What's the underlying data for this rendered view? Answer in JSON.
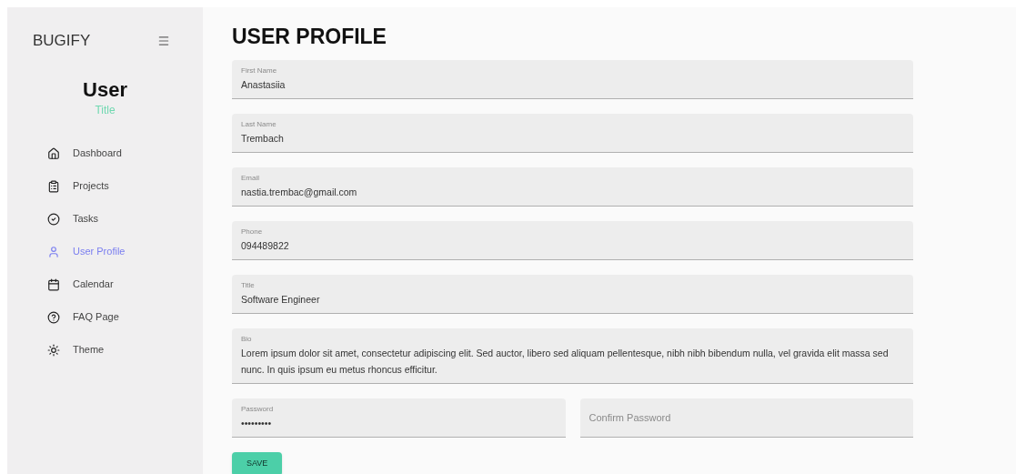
{
  "sidebar": {
    "brand": "BUGIFY",
    "user": {
      "name": "User",
      "title": "Title"
    },
    "items": [
      {
        "label": "Dashboard",
        "selected": false
      },
      {
        "label": "Projects",
        "selected": false
      },
      {
        "label": "Tasks",
        "selected": false
      },
      {
        "label": "User Profile",
        "selected": true
      },
      {
        "label": "Calendar",
        "selected": false
      },
      {
        "label": "FAQ Page",
        "selected": false
      },
      {
        "label": "Theme",
        "selected": false
      }
    ]
  },
  "page": {
    "title": "USER PROFILE",
    "rows": [
      [
        {
          "label": "First Name",
          "value": "Anastasiia"
        }
      ],
      [
        {
          "label": "Last Name",
          "value": "Trembach"
        }
      ],
      [
        {
          "label": "Email",
          "value": "nastia.trembac@gmail.com"
        }
      ],
      [
        {
          "label": "Phone",
          "value": "094489822"
        }
      ],
      [
        {
          "label": "Title",
          "value": "Software Engineer"
        }
      ],
      [
        {
          "label": "Bio",
          "value": "Lorem ipsum dolor sit amet, consectetur adipiscing elit. Sed auctor, libero sed aliquam pellentesque, nibh nibh bibendum nulla, vel gravida elit massa sed nunc. In quis ipsum eu metus rhoncus efficitur."
        }
      ],
      [
        {
          "label": "Password",
          "value": "•••••••••"
        },
        {
          "placeholder": "Confirm Password"
        }
      ]
    ],
    "save_button": "SAVE"
  }
}
